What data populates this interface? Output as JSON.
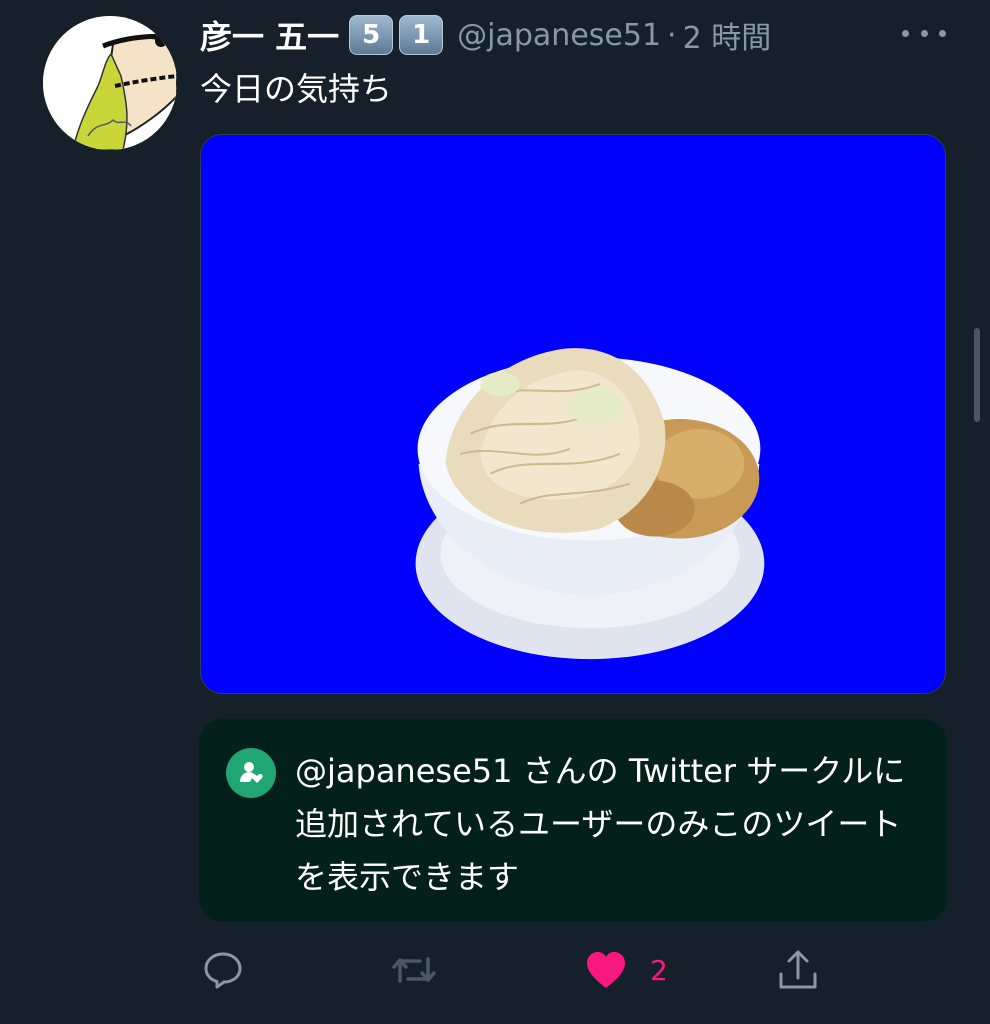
{
  "tweet": {
    "display_name": "彦一 五一",
    "badges": [
      "5",
      "1"
    ],
    "handle": "@japanese51",
    "separator": "·",
    "time": "2 時間",
    "text": "今日の気持ち",
    "media_icon": "ramen-bowl-image",
    "avatar_icon": "avatar-drawing"
  },
  "circle_notice": {
    "icon": "circle-members-icon",
    "text": "@japanese51 さんの Twitter サークルに追加されているユーザーのみこのツイートを表示できます",
    "background": "#04201a",
    "icon_color": "#1fa673"
  },
  "actions": {
    "reply_icon": "reply-icon",
    "retweet_icon": "retweet-icon",
    "like_icon": "heart-icon",
    "like_count": "2",
    "like_color": "#f91880",
    "share_icon": "share-icon"
  },
  "theme": {
    "background": "#15202b",
    "secondary_text": "#8899a6",
    "media_background": "#0000fd"
  }
}
